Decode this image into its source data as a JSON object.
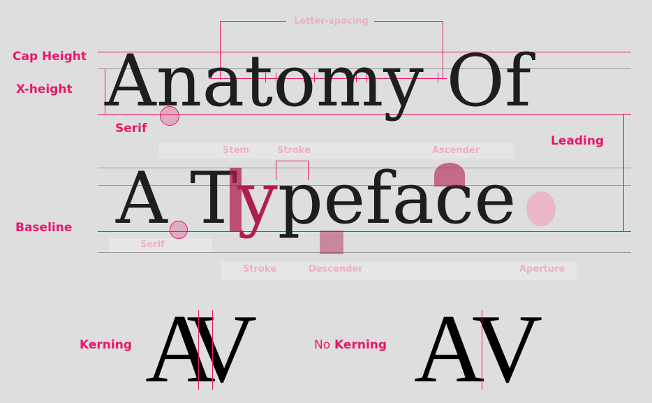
{
  "labels": {
    "cap_height": "Cap Height",
    "x_height": "X-height",
    "serif_top": "Serif",
    "leading": "Leading",
    "baseline": "Baseline",
    "kerning": "Kerning",
    "no_prefix": "No",
    "no_kerning_word": "Kerning"
  },
  "faint_labels": {
    "letter_spacing": "Letter-spacing",
    "stem": "Stem",
    "stroke_top": "Stroke",
    "ascender": "Ascender",
    "serif_bottom": "Serif",
    "stroke_bottom": "Stroke",
    "descender": "Descender",
    "aperture": "Aperture"
  },
  "specimen": {
    "line1": "Anatomy Of",
    "line2_a": "A",
    "line2_t": "T",
    "line2_y": "y",
    "line2_pe": "pe",
    "line2_f": "f",
    "line2_ace": "ace"
  },
  "kerning_pair": "AV",
  "colors": {
    "accent": "#e8176b",
    "faint_accent": "#ecb1c7",
    "background": "#dedede",
    "glyph_highlight": "#b01d53",
    "guide_line": "#9a9a9a"
  }
}
